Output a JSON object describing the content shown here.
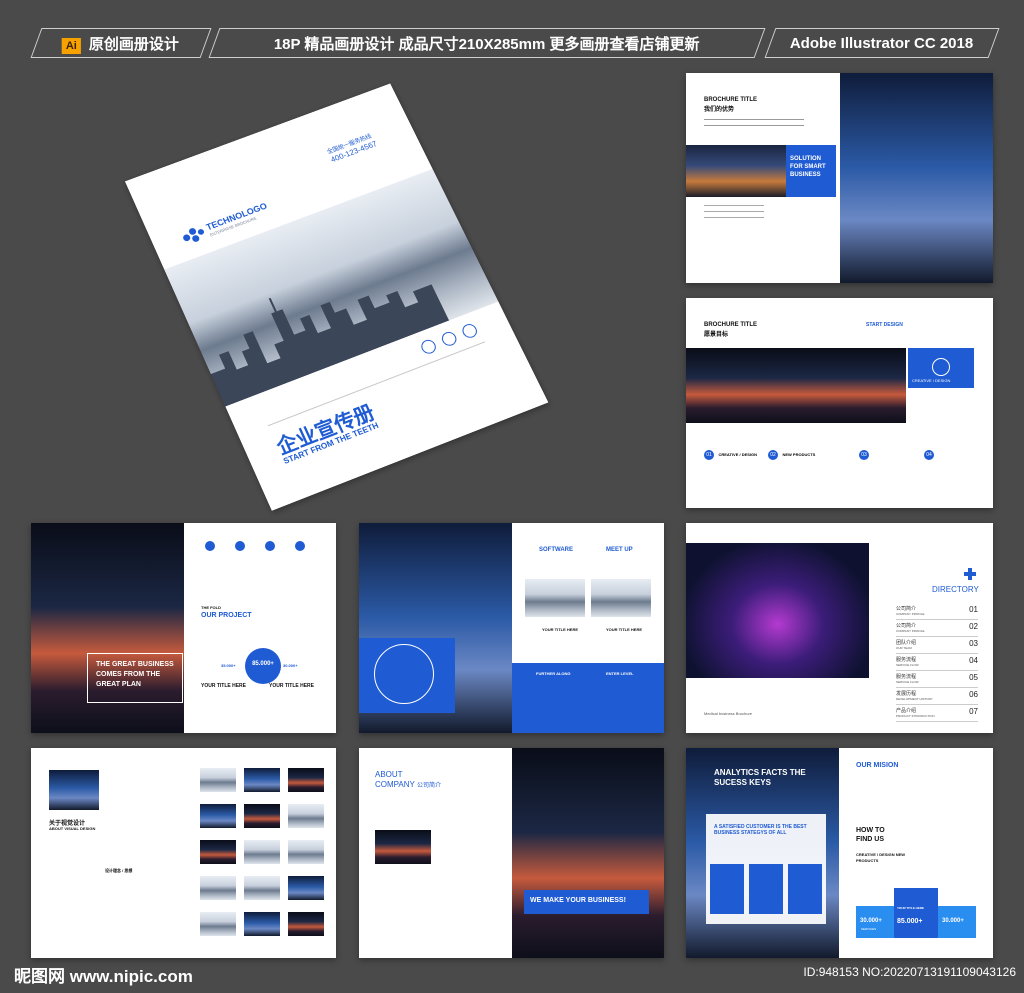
{
  "top_bar": {
    "ai_badge": "Ai",
    "segment1": "原创画册设计",
    "segment2": "18P 精品画册设计  成品尺寸210X285mm  更多画册查看店铺更新",
    "segment3": "Adobe Illustrator CC 2018"
  },
  "cover": {
    "logo": "TECHNOLOGO",
    "logo_sub": "ENTERPRISE BROCHURE",
    "contact_label": "全国统一服务热线",
    "phone": "400-123-4567",
    "title_cn": "企业宣传册",
    "title_en": "START FROM THE TEETH"
  },
  "spread1": {
    "title": "BROCHURE TITLE",
    "subtitle": "我们的优势",
    "box_text": "SOLUTION FOR SMART BUSINESS"
  },
  "spread2": {
    "title": "BROCHURE TITLE",
    "subtitle": "愿景目标",
    "side_title": "START DESIGN",
    "side_sub": "CREATIVE / DESIGN",
    "items": [
      "01",
      "02",
      "03",
      "04"
    ],
    "item_title": "CREATIVE / DESIGN",
    "item_sub": "NEW PRODUCTS"
  },
  "spread3": {
    "overlay": "THE GREAT BUSINESS COMES FROM THE GREAT PLAN",
    "fold": "THE FOLD",
    "project": "OUR PROJECT",
    "stat": "85.000+",
    "stat_left": "35.000+",
    "stat_right": "30.000+",
    "title_left": "YOUR TITLE HERE",
    "title_right": "YOUR TITLE HERE"
  },
  "spread4": {
    "software": "SOFTWARE",
    "meetup": "MEET UP",
    "title1": "YOUR TITLE HERE",
    "title2": "YOUR TITLE HERE",
    "further": "FURTHER ALONG",
    "enter": "ENTER LEVEL"
  },
  "spread5": {
    "directory": "DIRECTORY",
    "items": [
      {
        "cn": "公司简介",
        "en": "COMPANY PROFILE",
        "num": "01"
      },
      {
        "cn": "公司简介",
        "en": "COMPANY PROFILE",
        "num": "02"
      },
      {
        "cn": "团队介绍",
        "en": "OUR TEAM",
        "num": "03"
      },
      {
        "cn": "服务流程",
        "en": "SERVICE FLOW",
        "num": "04"
      },
      {
        "cn": "服务流程",
        "en": "SERVICE FLOW",
        "num": "05"
      },
      {
        "cn": "发展历程",
        "en": "DEVELOPMENT HISTORY",
        "num": "06"
      },
      {
        "cn": "产品介绍",
        "en": "PRODUCT INTRODUCTION",
        "num": "07"
      }
    ],
    "caption": "Medical business Brochure"
  },
  "spread6": {
    "title_cn": "关于视觉设计",
    "title_en": "ABOUT VISUAL DESIGN",
    "design_label": "设计理念 / 思想"
  },
  "spread7": {
    "about": "ABOUT",
    "company": "COMPANY",
    "company_cn": "公司简介",
    "banner": "WE MAKE YOUR BUSINESS!"
  },
  "spread8": {
    "analytics": "ANALYTICS FACTS THE SUCESS KEYS",
    "customer": "A SATISFIED CUSTOMER IS THE BEST BUSINESS STATEGYS OF ALL",
    "mission": "OUR MISION",
    "find": "HOW TO FIND US",
    "creative": "CREATIVE / DESIGN NEW PRODUCTS",
    "title_here": "YOUR TITLE HERE",
    "stat1": "30.000+",
    "stat2": "85.000+",
    "stat3": "30.000+",
    "services": "SERVICES"
  },
  "footer": {
    "brand": "昵图网 www.nipic.com",
    "id": "ID:948153 NO:20220713191109043126"
  }
}
